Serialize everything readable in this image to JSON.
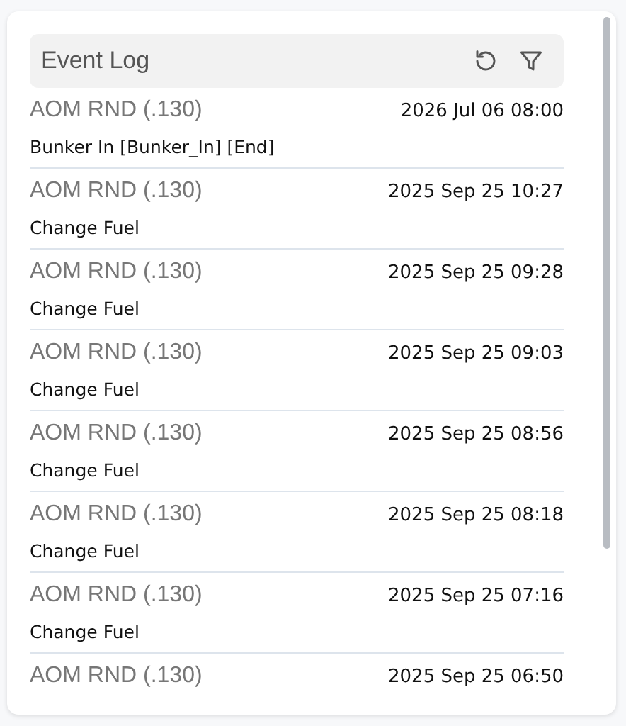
{
  "panel": {
    "title": "Event Log"
  },
  "events": [
    {
      "source": "AOM RND (.130)",
      "time": "2026 Jul 06 08:00",
      "description": "Bunker In [Bunker_In] [End]"
    },
    {
      "source": "AOM RND (.130)",
      "time": "2025 Sep 25 10:27",
      "description": "Change Fuel"
    },
    {
      "source": "AOM RND (.130)",
      "time": "2025 Sep 25 09:28",
      "description": "Change Fuel"
    },
    {
      "source": "AOM RND (.130)",
      "time": "2025 Sep 25 09:03",
      "description": "Change Fuel"
    },
    {
      "source": "AOM RND (.130)",
      "time": "2025 Sep 25 08:56",
      "description": "Change Fuel"
    },
    {
      "source": "AOM RND (.130)",
      "time": "2025 Sep 25 08:18",
      "description": "Change Fuel"
    },
    {
      "source": "AOM RND (.130)",
      "time": "2025 Sep 25 07:16",
      "description": "Change Fuel"
    },
    {
      "source": "AOM RND (.130)",
      "time": "2025 Sep 25 06:50"
    }
  ]
}
